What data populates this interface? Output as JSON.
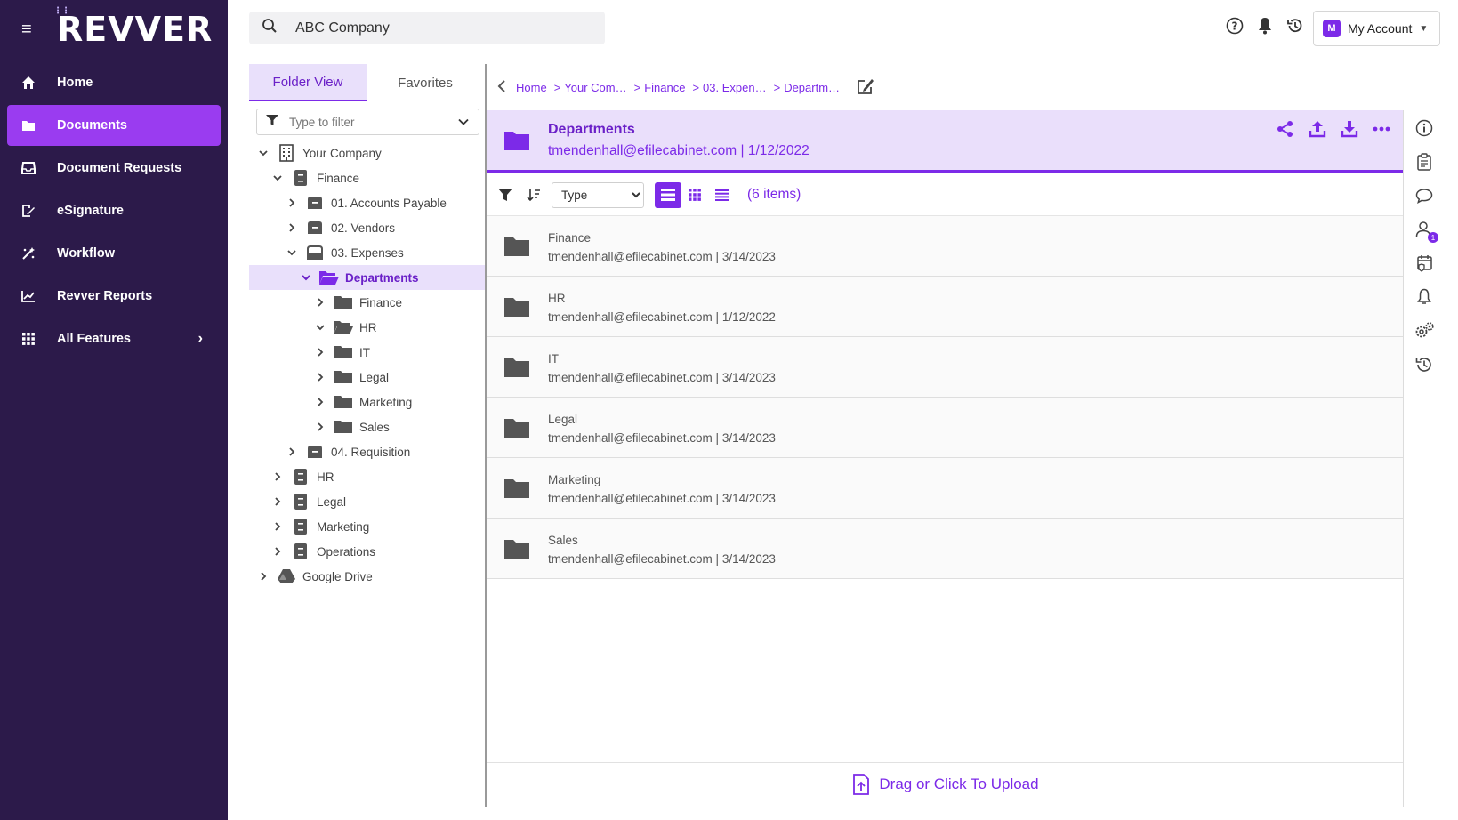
{
  "app": {
    "logo_text": "REVVER",
    "brand_color": "#7c2ae8",
    "sidebar_color": "#2c1a4a"
  },
  "sidebar": {
    "items": [
      {
        "label": "Home",
        "icon": "home-icon"
      },
      {
        "label": "Documents",
        "icon": "folder-icon",
        "active": true
      },
      {
        "label": "Document Requests",
        "icon": "inbox-icon"
      },
      {
        "label": "eSignature",
        "icon": "signature-icon"
      },
      {
        "label": "Workflow",
        "icon": "workflow-icon"
      },
      {
        "label": "Revver Reports",
        "icon": "chart-icon"
      },
      {
        "label": "All Features",
        "icon": "grid-icon"
      }
    ]
  },
  "search": {
    "value": "ABC Company"
  },
  "account": {
    "avatar_letter": "M",
    "label": "My Account"
  },
  "tree_panel": {
    "tabs": [
      "Folder View",
      "Favorites"
    ],
    "filter_placeholder": "Type to filter",
    "nodes": [
      {
        "label": "Your Company"
      },
      {
        "label": "Finance"
      },
      {
        "label": "01. Accounts Payable"
      },
      {
        "label": "02. Vendors"
      },
      {
        "label": "03. Expenses"
      },
      {
        "label": "Departments"
      },
      {
        "label": "Finance"
      },
      {
        "label": "HR"
      },
      {
        "label": "IT"
      },
      {
        "label": "Legal"
      },
      {
        "label": "Marketing"
      },
      {
        "label": "Sales"
      },
      {
        "label": "04. Requisition"
      },
      {
        "label": "HR"
      },
      {
        "label": "Legal"
      },
      {
        "label": "Marketing"
      },
      {
        "label": "Operations"
      },
      {
        "label": "Google Drive"
      }
    ]
  },
  "breadcrumb": {
    "items": [
      "Home",
      "Your Com…",
      "Finance",
      "03. Expen…",
      "Departm…"
    ],
    "separator": ">"
  },
  "folder": {
    "title": "Departments",
    "subtitle": "tmendenhall@efilecabinet.com | 1/12/2022"
  },
  "toolbar": {
    "sort_select": "Type",
    "sort_options": [
      "Type"
    ],
    "item_count": "(6 items)"
  },
  "items": [
    {
      "name": "Finance",
      "meta": "tmendenhall@efilecabinet.com | 3/14/2023"
    },
    {
      "name": "HR",
      "meta": "tmendenhall@efilecabinet.com | 1/12/2022"
    },
    {
      "name": "IT",
      "meta": "tmendenhall@efilecabinet.com | 3/14/2023"
    },
    {
      "name": "Legal",
      "meta": "tmendenhall@efilecabinet.com | 3/14/2023"
    },
    {
      "name": "Marketing",
      "meta": "tmendenhall@efilecabinet.com | 3/14/2023"
    },
    {
      "name": "Sales",
      "meta": "tmendenhall@efilecabinet.com | 3/14/2023"
    }
  ],
  "upload": {
    "label": "Drag or Click To Upload"
  },
  "right_rail": {
    "notification_badge": "1"
  }
}
